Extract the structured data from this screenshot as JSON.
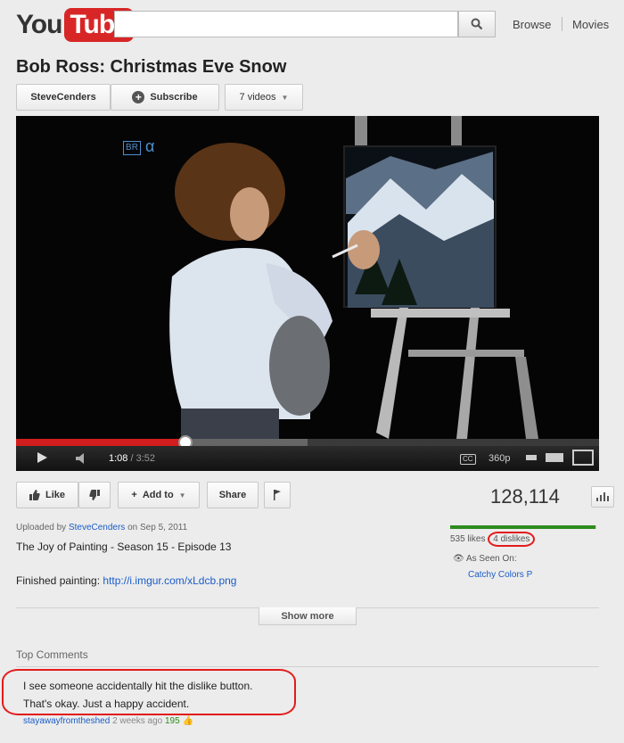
{
  "header": {
    "logo_you": "You",
    "logo_tube": "Tube",
    "search_value": "",
    "nav_browse": "Browse",
    "nav_movies": "Movies"
  },
  "video": {
    "title": "Bob Ross: Christmas Eve Snow",
    "channel": "SteveCenders",
    "subscribe": "Subscribe",
    "videos_count": "7 videos",
    "channel_watermark": "BR",
    "time_current": "1:08",
    "time_duration": "/ 3:52",
    "progress_fraction": 0.29,
    "buffered_fraction": 0.5,
    "quality": "360p",
    "cc_label": "CC"
  },
  "actions": {
    "like": "Like",
    "add_to": "Add to",
    "share": "Share",
    "views": "128,114"
  },
  "ratings": {
    "likes": "535 likes",
    "dislikes": "4 dislikes",
    "like_ratio": 0.993,
    "as_seen_on": "As Seen On:",
    "seen_on_site": "Catchy Colors P"
  },
  "description": {
    "uploaded_prefix": "Uploaded by",
    "uploader": "SteveCenders",
    "uploaded_on": "on Sep 5, 2011",
    "line1": "The Joy of Painting - Season 15 - Episode 13",
    "finished_label": "Finished painting:",
    "finished_link": "http://i.imgur.com/xLdcb.png",
    "show_more": "Show more"
  },
  "comments": {
    "heading": "Top Comments",
    "items": [
      {
        "line1": "I see someone accidentally hit the dislike button.",
        "line2": "That's okay. Just a happy accident.",
        "author": "stayawayfromtheshed",
        "age": "2 weeks ago",
        "votes": "195"
      }
    ]
  },
  "colors": {
    "brand_red": "#d82626",
    "progress_red": "#d21e1e",
    "like_green": "#2e8b1e",
    "link_blue": "#1a5cc8",
    "annotation_red": "#e41b1b"
  }
}
